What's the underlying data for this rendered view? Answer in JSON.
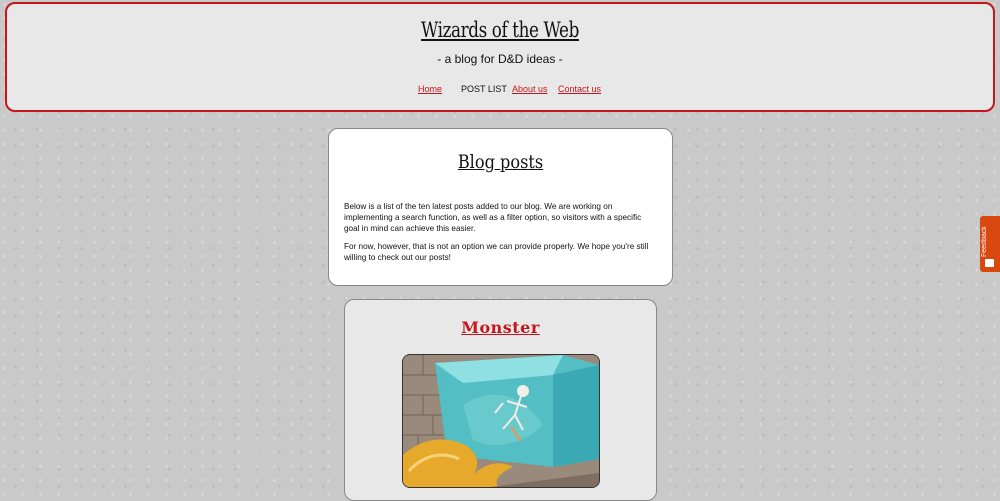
{
  "header": {
    "title": "Wizards of the Web",
    "tagline": "- a blog for D&D ideas -",
    "nav": {
      "home": "Home",
      "post_list": "POST LIST",
      "about": "About us",
      "contact": "Contact us"
    }
  },
  "intro": {
    "heading": "Blog posts",
    "paragraph1": "Below is a list of the ten latest posts added to our blog. We are working on implementing a search function, as well as a filter option, so visitors with a specific goal in mind can achieve this easier.",
    "paragraph2": "For now, however, that is not an option we can provide properly. We hope you're still willing to check out our posts!"
  },
  "post": {
    "title": "Monster",
    "image_icon": "gelatinous-cube-illustration"
  },
  "feedback": {
    "label": "Feedback",
    "icon": "feedback-icon"
  },
  "colors": {
    "accent_red": "#c4161c",
    "feedback_orange": "#d9480f",
    "panel_gray": "#e8e8e8",
    "page_background": "#c9c9c9"
  }
}
